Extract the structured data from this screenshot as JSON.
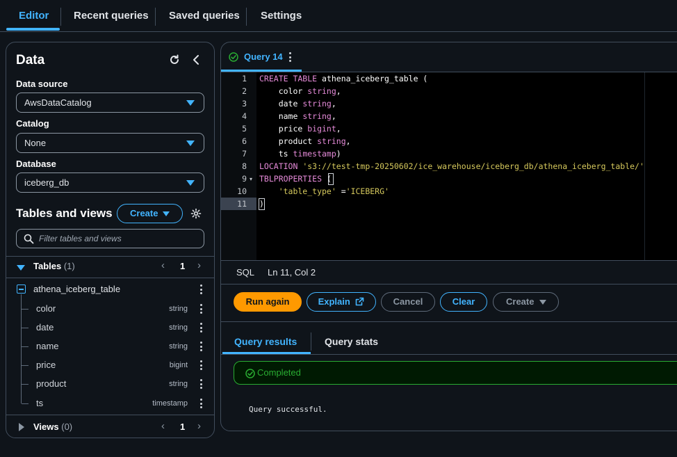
{
  "top_tabs": [
    "Editor",
    "Recent queries",
    "Saved queries",
    "Settings"
  ],
  "data_panel": {
    "title": "Data",
    "data_source_label": "Data source",
    "data_source_value": "AwsDataCatalog",
    "catalog_label": "Catalog",
    "catalog_value": "None",
    "database_label": "Database",
    "database_value": "iceberg_db",
    "tables_and_views_title": "Tables and views",
    "create_button": "Create",
    "filter_placeholder": "Filter tables and views",
    "tables_label": "Tables",
    "tables_count": "(1)",
    "tables_page": "1",
    "table_name": "athena_iceberg_table",
    "columns": [
      {
        "name": "color",
        "type": "string"
      },
      {
        "name": "date",
        "type": "string"
      },
      {
        "name": "name",
        "type": "string"
      },
      {
        "name": "price",
        "type": "bigint"
      },
      {
        "name": "product",
        "type": "string"
      },
      {
        "name": "ts",
        "type": "timestamp"
      }
    ],
    "views_label": "Views",
    "views_count": "(0)",
    "views_page": "1"
  },
  "editor": {
    "query_tab": "Query 14",
    "line_numbers": [
      "1",
      "2",
      "3",
      "4",
      "5",
      "6",
      "7",
      "8",
      "9",
      "10",
      "11"
    ],
    "code": {
      "l1_kw": "CREATE TABLE",
      "l1_rest": " athena_iceberg_table (",
      "l2_name": "    color",
      "l2_type": " string",
      "l2_end": ",",
      "l3_name": "    date",
      "l3_type": " string",
      "l3_end": ",",
      "l4_name": "    name",
      "l4_type": " string",
      "l4_end": ",",
      "l5_name": "    price",
      "l5_type": " bigint",
      "l5_end": ",",
      "l6_name": "    product",
      "l6_type": " string",
      "l6_end": ",",
      "l7_name": "    ts",
      "l7_type": " timestamp",
      "l7_end": ")",
      "l8_kw": "LOCATION",
      "l8_str": " 's3://test-tmp-20250602/ice_warehouse/iceberg_db/athena_iceberg_table/'",
      "l9_kw": "TBLPROPERTIES",
      "l9_rest": " (",
      "l10_str1": "    'table_type'",
      "l10_eq": " =",
      "l10_str2": "'ICEBERG'",
      "l11": ")"
    },
    "language": "SQL",
    "cursor_position": "Ln 11, Col 2"
  },
  "actions": {
    "run_again": "Run again",
    "explain": "Explain",
    "cancel": "Cancel",
    "clear": "Clear",
    "create": "Create"
  },
  "results": {
    "tab_results": "Query results",
    "tab_stats": "Query stats",
    "status": "Completed",
    "message": "Query successful."
  },
  "colors": {
    "accent": "#42b4ff",
    "primary_button": "#ff9900",
    "success": "#29ad32",
    "background": "#0f141a"
  }
}
